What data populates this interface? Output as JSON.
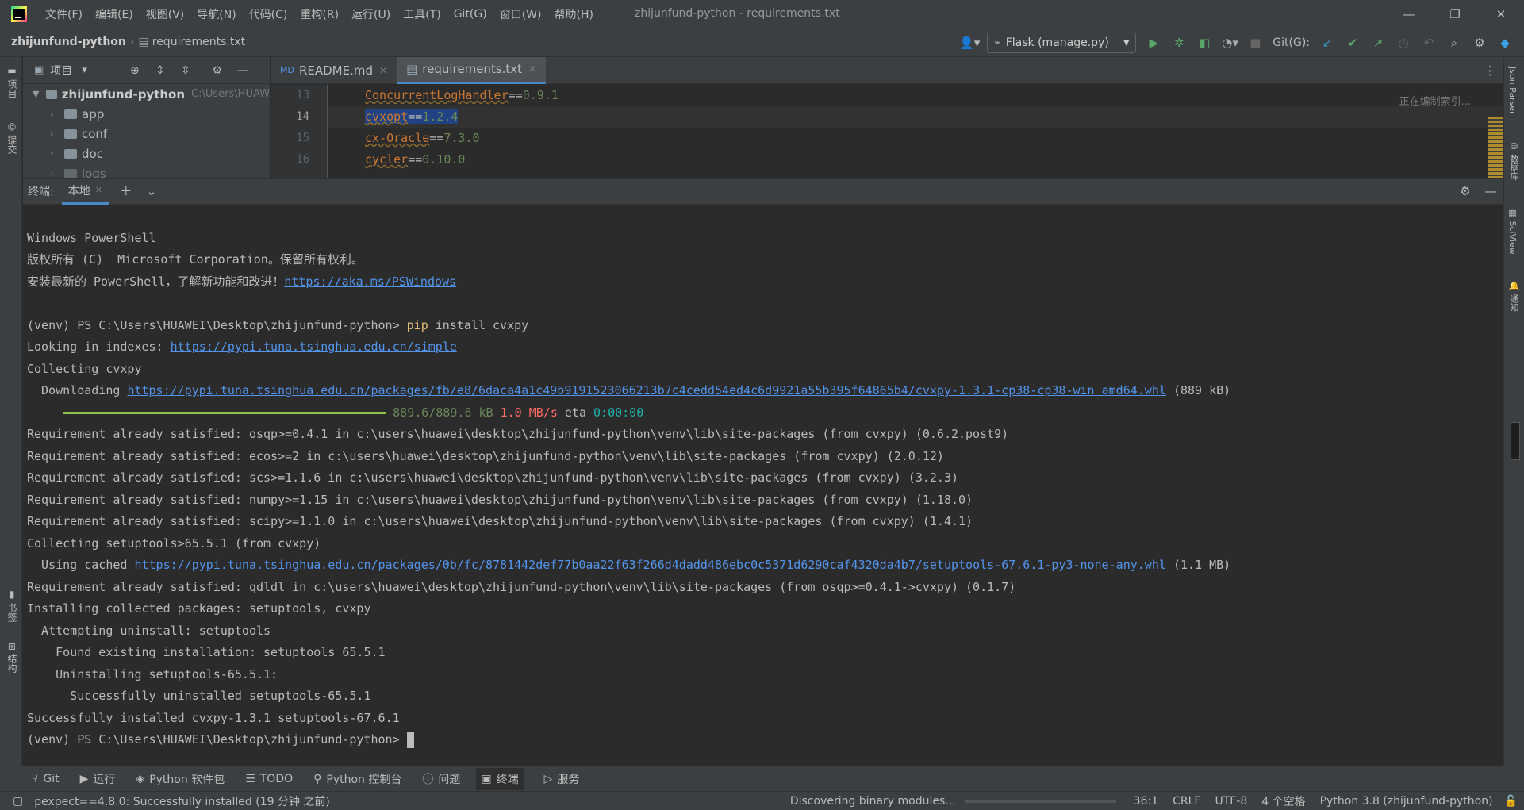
{
  "titlebar": {
    "menus": [
      "文件(F)",
      "编辑(E)",
      "视图(V)",
      "导航(N)",
      "代码(C)",
      "重构(R)",
      "运行(U)",
      "工具(T)",
      "Git(G)",
      "窗口(W)",
      "帮助(H)"
    ],
    "window_title": "zhijunfund-python - requirements.txt"
  },
  "navbar": {
    "project": "zhijunfund-python",
    "file": "requirements.txt",
    "run_config": "Flask (manage.py)",
    "git_label": "Git(G):"
  },
  "left_strip": {
    "project": "项目",
    "commit": "提交",
    "bookmarks": "书签",
    "structure": "结构"
  },
  "right_strip": {
    "json_parser": "Json Parser",
    "database": "数据库",
    "sciview": "SciView",
    "notifications": "通知"
  },
  "project_panel": {
    "title": "项目",
    "root": "zhijunfund-python",
    "root_path": "C:\\Users\\HUAW",
    "children": [
      "app",
      "conf",
      "doc",
      "logs"
    ]
  },
  "editor": {
    "tabs": [
      {
        "label": "README.md"
      },
      {
        "label": "requirements.txt"
      }
    ],
    "indexing": "正在编制索引...",
    "lines": [
      {
        "n": "13",
        "pkg": "ConcurrentLogHandler",
        "op": "==",
        "ver": "0.9.1"
      },
      {
        "n": "14",
        "pkg": "cvxopt",
        "op": "==",
        "ver": "1.2.4"
      },
      {
        "n": "15",
        "pkg": "cx-Oracle",
        "op": "==",
        "ver": "7.3.0"
      },
      {
        "n": "16",
        "pkg": "cycler",
        "op": "==",
        "ver": "0.10.0"
      }
    ]
  },
  "terminal": {
    "label": "终端:",
    "tab": "本地",
    "l1": "Windows PowerShell",
    "l2": "版权所有 (C)  Microsoft Corporation。保留所有权利。",
    "l3_text": "安装最新的 PowerShell，了解新功能和改进！",
    "l3_link": "https://aka.ms/PSWindows",
    "prompt": "(venv) PS C:\\Users\\HUAWEI\\Desktop\\zhijunfund-python>",
    "cmd_pip": "pip",
    "cmd_rest": "install cvxpy",
    "l5_text": "Looking in indexes:",
    "l5_link": "https://pypi.tuna.tsinghua.edu.cn/simple",
    "l6": "Collecting cvxpy",
    "l7_text": "  Downloading",
    "l7_link": "https://pypi.tuna.tsinghua.edu.cn/packages/fb/e8/6daca4a1c49b9191523066213b7c4cedd54ed4c6d9921a55b395f64865b4/cvxpy-1.3.1-cp38-cp38-win_amd64.whl",
    "l7_size": "(889 kB)",
    "progress_size": "889.6/889.6 kB",
    "progress_speed": "1.0 MB/s",
    "progress_eta_label": "eta",
    "progress_eta": "0:00:00",
    "progress_fraction": 1.0,
    "l9": "Requirement already satisfied: osqp>=0.4.1 in c:\\users\\huawei\\desktop\\zhijunfund-python\\venv\\lib\\site-packages (from cvxpy) (0.6.2.post9)",
    "l10": "Requirement already satisfied: ecos>=2 in c:\\users\\huawei\\desktop\\zhijunfund-python\\venv\\lib\\site-packages (from cvxpy) (2.0.12)",
    "l11": "Requirement already satisfied: scs>=1.1.6 in c:\\users\\huawei\\desktop\\zhijunfund-python\\venv\\lib\\site-packages (from cvxpy) (3.2.3)",
    "l12": "Requirement already satisfied: numpy>=1.15 in c:\\users\\huawei\\desktop\\zhijunfund-python\\venv\\lib\\site-packages (from cvxpy) (1.18.0)",
    "l13": "Requirement already satisfied: scipy>=1.1.0 in c:\\users\\huawei\\desktop\\zhijunfund-python\\venv\\lib\\site-packages (from cvxpy) (1.4.1)",
    "l14": "Collecting setuptools>65.5.1 (from cvxpy)",
    "l15_text": "  Using cached",
    "l15_link": "https://pypi.tuna.tsinghua.edu.cn/packages/0b/fc/8781442def77b0aa22f63f266d4dadd486ebc0c5371d6290caf4320da4b7/setuptools-67.6.1-py3-none-any.whl",
    "l15_size": "(1.1 MB)",
    "l16": "Requirement already satisfied: qdldl in c:\\users\\huawei\\desktop\\zhijunfund-python\\venv\\lib\\site-packages (from osqp>=0.4.1->cvxpy) (0.1.7)",
    "l17": "Installing collected packages: setuptools, cvxpy",
    "l18": "  Attempting uninstall: setuptools",
    "l19": "    Found existing installation: setuptools 65.5.1",
    "l20": "    Uninstalling setuptools-65.5.1:",
    "l21": "      Successfully uninstalled setuptools-65.5.1",
    "l22": "Successfully installed cvxpy-1.3.1 setuptools-67.6.1"
  },
  "toolwindows": [
    "Git",
    "运行",
    "Python 软件包",
    "TODO",
    "Python 控制台",
    "问题",
    "终端",
    "服务"
  ],
  "statusbar": {
    "message": "pexpect==4.8.0: Successfully installed (19 分钟 之前)",
    "task": "Discovering binary modules...",
    "position": "36:1",
    "line_sep": "CRLF",
    "encoding": "UTF-8",
    "indent": "4 个空格",
    "interpreter": "Python 3.8 (zhijunfund-python)"
  }
}
